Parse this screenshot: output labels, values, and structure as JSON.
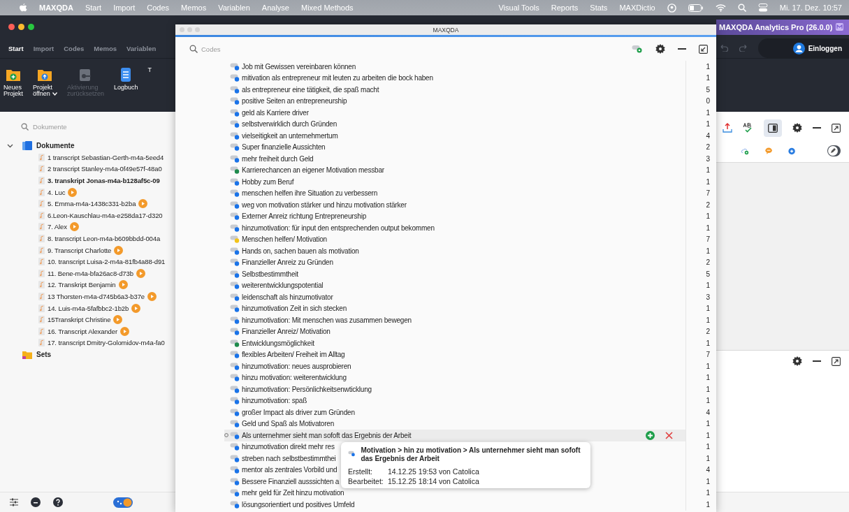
{
  "menu_bar": {
    "app": "MAXQDA",
    "items": [
      "Start",
      "Import",
      "Codes",
      "Memos",
      "Variablen",
      "Analyse",
      "Mixed Methods"
    ],
    "right_items": [
      "Visual Tools",
      "Reports",
      "Stats",
      "MAXDictio"
    ],
    "clock": "Mi. 17. Dez. 10:57"
  },
  "main_window": {
    "edition": "MAXQDA Analytics Pro (26.0.0)",
    "login": "Einloggen",
    "tabs": [
      {
        "label": "Start",
        "selected": true
      },
      {
        "label": "Import",
        "selected": false
      },
      {
        "label": "Codes",
        "selected": false
      },
      {
        "label": "Memos",
        "selected": false
      },
      {
        "label": "Variablen",
        "selected": false
      }
    ],
    "ribbon": [
      {
        "kind": "new",
        "label": "Neues\nProjekt",
        "disabled": false
      },
      {
        "kind": "open",
        "label": "Projekt\nöffnen",
        "disabled": false
      },
      {
        "kind": "reset",
        "label": "Aktivierung\nzurücksetzen",
        "disabled": true
      },
      {
        "kind": "log",
        "label": "Logbuch",
        "disabled": false
      },
      {
        "kind": "text",
        "label": "T",
        "disabled": false
      }
    ],
    "preview_panel_on": true,
    "edit_mode": false
  },
  "documents": {
    "placeholder": "Dokumente",
    "tree": [
      {
        "label": "Dokumente",
        "kind": "folder",
        "expanded": true,
        "children": [
          {
            "label": "1 transcript Sebastian-Gerth-m4a-5eed4",
            "active": false,
            "media": false
          },
          {
            "label": "2 transcript Stanley-m4a-0f49e57f-48a0",
            "active": false,
            "media": false
          },
          {
            "label": "3. transkript Jonas-m4a-b128af5c-09",
            "active": true,
            "media": false
          },
          {
            "label": "4. Luc",
            "active": false,
            "media": true
          },
          {
            "label": "5. Emma-m4a-1438c331-b2ba",
            "active": false,
            "media": true
          },
          {
            "label": "6.Leon-Kauschlau-m4a-e258da17-d320",
            "active": false,
            "media": false
          },
          {
            "label": "7. Alex",
            "active": false,
            "media": true
          },
          {
            "label": "8. transcript Leon-m4a-b609bbdd-004a",
            "active": false,
            "media": false
          },
          {
            "label": "9. Transcript Charlotte",
            "active": false,
            "media": true
          },
          {
            "label": "10. transcript Luisa-2-m4a-81fb4a88-d91",
            "active": false,
            "media": false
          },
          {
            "label": "11. Bene-m4a-bfa26ac8-d73b",
            "active": false,
            "media": true
          },
          {
            "label": "12. Transkript Benjamin",
            "active": false,
            "media": true
          },
          {
            "label": "13 Thorsten-m4a-d745b6a3-b37e",
            "active": false,
            "media": true
          },
          {
            "label": "14. Luis-m4a-5fafbbc2-1b2b",
            "active": false,
            "media": true
          },
          {
            "label": "15Transkript Christine",
            "active": false,
            "media": true
          },
          {
            "label": "16. Transcript Alexander",
            "active": false,
            "media": true
          },
          {
            "label": "17. transcript Dmitry-Golomidov-m4a-fa0",
            "active": false,
            "media": false
          }
        ]
      },
      {
        "label": "Sets",
        "kind": "sets",
        "expanded": false
      }
    ]
  },
  "codes_window": {
    "title": "MAXQDA",
    "placeholder": "Codes",
    "codes": [
      {
        "label": "Job mit Gewissen vereinbaren können",
        "count": "1",
        "color": "#1a73e8",
        "selected": false
      },
      {
        "label": "mitivation als entrepreneur mit leuten zu arbeiten die bock haben",
        "count": "1",
        "color": "#1a73e8",
        "selected": false
      },
      {
        "label": "als entrepreneur eine tätigkeit, die spaß macht",
        "count": "5",
        "color": "#1a73e8",
        "selected": false
      },
      {
        "label": "positive Seiten an entrepreneurship",
        "count": "0",
        "color": "#1a73e8",
        "selected": false
      },
      {
        "label": "geld als Karriere driver",
        "count": "1",
        "color": "#1a73e8",
        "selected": false
      },
      {
        "label": "selbstverwirklich durch Gründen",
        "count": "1",
        "color": "#1a73e8",
        "selected": false
      },
      {
        "label": "vielseitigkeit an unternehmertum",
        "count": "4",
        "color": "#1a73e8",
        "selected": false
      },
      {
        "label": "Super finanzielle Aussichten",
        "count": "2",
        "color": "#1a73e8",
        "selected": false
      },
      {
        "label": "mehr freiheit durch Geld",
        "count": "3",
        "color": "#1a73e8",
        "selected": false
      },
      {
        "label": "Karrierechancen an eigener Motivation messbar",
        "count": "1",
        "color": "#1e8a4c",
        "selected": false
      },
      {
        "label": "Hobby zum Beruf",
        "count": "1",
        "color": "#1a73e8",
        "selected": false
      },
      {
        "label": "menschen helfen ihre Situation zu verbessern",
        "count": "7",
        "color": "#1a73e8",
        "selected": false
      },
      {
        "label": "weg von motivation stärker und hinzu motivation stärker",
        "count": "2",
        "color": "#1a73e8",
        "selected": false
      },
      {
        "label": "Externer Anreiz richtung Entrepreneurship",
        "count": "1",
        "color": "#1a73e8",
        "selected": false
      },
      {
        "label": "hinzumotivation: für input den entsprechenden output bekommen",
        "count": "1",
        "color": "#1a73e8",
        "selected": false
      },
      {
        "label": "Menschen helfen/ Motivation",
        "count": "7",
        "color": "#f2c318",
        "selected": false
      },
      {
        "label": "Hands on, sachen bauen als motivation",
        "count": "1",
        "color": "#1a73e8",
        "selected": false
      },
      {
        "label": "Finanzieller Anreiz zu Gründen",
        "count": "2",
        "color": "#1a73e8",
        "selected": false
      },
      {
        "label": "Selbstbestimmtheit",
        "count": "5",
        "color": "#1a73e8",
        "selected": false
      },
      {
        "label": "weiterentwicklungspotential",
        "count": "1",
        "color": "#1a73e8",
        "selected": false
      },
      {
        "label": "leidenschaft als hinzumotivator",
        "count": "3",
        "color": "#1a73e8",
        "selected": false
      },
      {
        "label": "hinzumotivation Zeit in sich stecken",
        "count": "1",
        "color": "#1a73e8",
        "selected": false
      },
      {
        "label": "hinzumotivation: Mit menschen was zusammen bewegen",
        "count": "1",
        "color": "#1a73e8",
        "selected": false
      },
      {
        "label": "Finanzieller Anreiz/ Motivation",
        "count": "2",
        "color": "#1a73e8",
        "selected": false
      },
      {
        "label": "Entwicklungsmöglichkeit",
        "count": "1",
        "color": "#1e8a4c",
        "selected": false
      },
      {
        "label": "flexibles Arbeiten/ Freiheit im Alltag",
        "count": "7",
        "color": "#1a73e8",
        "selected": false
      },
      {
        "label": "hinzumotivation: neues ausprobieren",
        "count": "1",
        "color": "#1a73e8",
        "selected": false
      },
      {
        "label": "hinzu motivation: weiterentwicklung",
        "count": "1",
        "color": "#1a73e8",
        "selected": false
      },
      {
        "label": "hinzumotivation: Persönlichkeitsenwticklung",
        "count": "1",
        "color": "#1a73e8",
        "selected": false
      },
      {
        "label": "hinzumotivation: spaß",
        "count": "1",
        "color": "#1a73e8",
        "selected": false
      },
      {
        "label": "großer Impact als driver zum Gründen",
        "count": "4",
        "color": "#1a73e8",
        "selected": false
      },
      {
        "label": "Geld und Spaß als Motivatoren",
        "count": "1",
        "color": "#1a73e8",
        "selected": false
      },
      {
        "label": "Als unternehmer sieht man sofoft das Ergebnis der Arbeit",
        "count": "1",
        "color": "#1a73e8",
        "selected": true
      },
      {
        "label": "hinzumotivation direkt mehr res",
        "count": "1",
        "color": "#1a73e8",
        "selected": false
      },
      {
        "label": "streben nach selbstbestimmthei",
        "count": "1",
        "color": "#1a73e8",
        "selected": false
      },
      {
        "label": "mentor als zentrales Vorbild und",
        "count": "4",
        "color": "#1a73e8",
        "selected": false
      },
      {
        "label": "Bessere Finanziell ausssichten a",
        "count": "1",
        "color": "#1a73e8",
        "selected": false
      },
      {
        "label": "mehr geld für Zeit hinzu motivation",
        "count": "1",
        "color": "#1a73e8",
        "selected": false
      },
      {
        "label": "lösungsorientiert und positives Umfeld",
        "count": "1",
        "color": "#1a73e8",
        "selected": false
      }
    ],
    "tooltip": {
      "path": "Motivation > hin zu motivation > Als unternehmer sieht man sofoft das Ergebnis der Arbeit",
      "rows": [
        {
          "label": "Erstellt:",
          "value": "14.12.25 19:53 von Catolica"
        },
        {
          "label": "Bearbeitet:",
          "value": "15.12.25 18:14 von Catolica"
        }
      ]
    }
  }
}
